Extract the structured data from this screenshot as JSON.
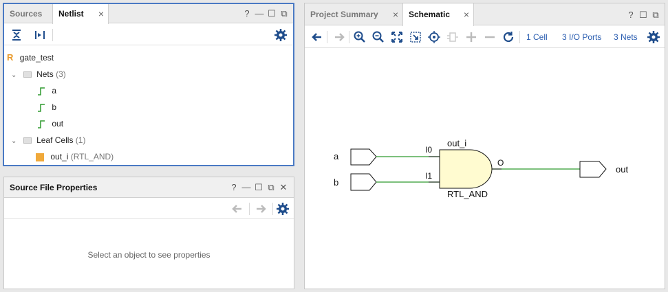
{
  "netlist_panel": {
    "tabs": [
      {
        "label": "Sources"
      },
      {
        "label": "Netlist"
      }
    ],
    "controls": [
      "?",
      "—",
      "☐",
      "⧉"
    ],
    "tree": {
      "root": {
        "label": "gate_test",
        "icon_letter": "R"
      },
      "nets": {
        "label": "Nets",
        "count": "(3)",
        "items": [
          "a",
          "b",
          "out"
        ]
      },
      "leaf_cells": {
        "label": "Leaf Cells",
        "count": "(1)",
        "items": [
          {
            "name": "out_i",
            "type": "(RTL_AND)"
          }
        ]
      }
    }
  },
  "properties_panel": {
    "title": "Source File Properties",
    "empty_message": "Select an object to see properties"
  },
  "schematic_panel": {
    "tabs": [
      {
        "label": "Project Summary"
      },
      {
        "label": "Schematic"
      }
    ],
    "toolbar_links": {
      "cells": "1 Cell",
      "ports": "3 I/O Ports",
      "nets": "3 Nets"
    },
    "schematic": {
      "inputs": [
        "a",
        "b"
      ],
      "output": "out",
      "gate_instance": "out_i",
      "gate_type": "RTL_AND",
      "pin_i0": "I0",
      "pin_i1": "I1",
      "pin_o": "O"
    }
  },
  "colors": {
    "accent_border": "#4a7ac4",
    "wire": "#2e9a2e",
    "gate_fill": "#fffbd0",
    "link": "#2a5db0",
    "cell_icon": "#f0a93a"
  }
}
